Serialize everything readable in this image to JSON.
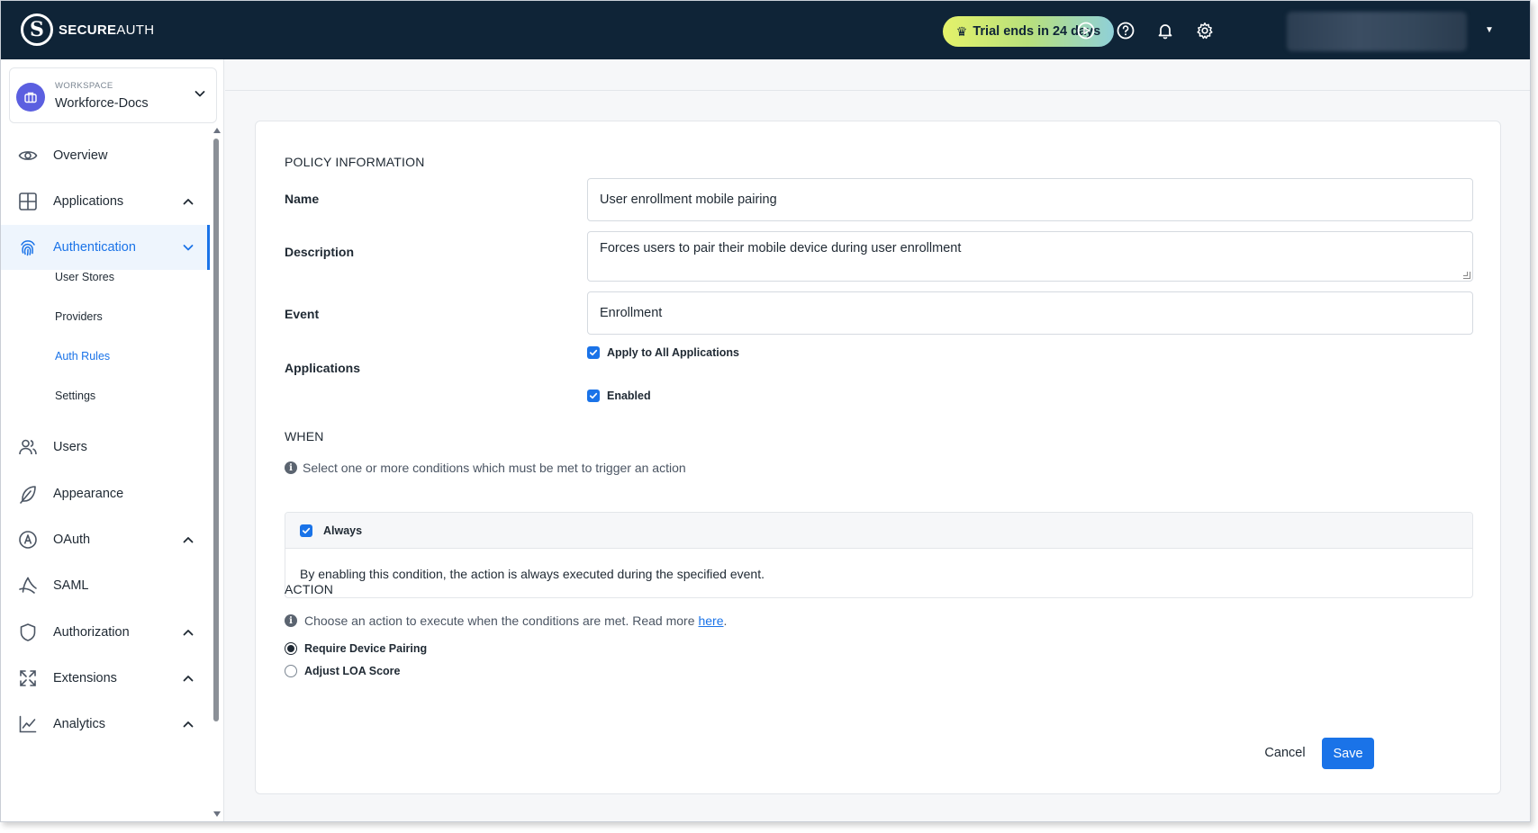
{
  "brand": {
    "name_bold": "SECURE",
    "name_light": "AUTH"
  },
  "header": {
    "trial_text": "Trial ends in 24 days",
    "icons": [
      "play-circle-icon",
      "help-circle-icon",
      "bell-icon",
      "gear-icon"
    ],
    "trial_gradient": [
      "#e4f26a",
      "#8fd0d8"
    ]
  },
  "workspace": {
    "label": "WORKSPACE",
    "name": "Workforce-Docs"
  },
  "sidebar": {
    "items": [
      {
        "label": "Overview",
        "icon": "eye-icon"
      },
      {
        "label": "Applications",
        "icon": "grid-icon"
      },
      {
        "label": "Authentication",
        "icon": "fingerprint-icon",
        "active": true
      },
      {
        "label": "Users",
        "icon": "users-icon"
      },
      {
        "label": "Appearance",
        "icon": "feather-icon"
      },
      {
        "label": "OAuth",
        "icon": "oauth-icon"
      },
      {
        "label": "SAML",
        "icon": "saml-icon"
      },
      {
        "label": "Authorization",
        "icon": "shield-icon"
      },
      {
        "label": "Extensions",
        "icon": "expand-icon"
      },
      {
        "label": "Analytics",
        "icon": "chart-line-icon"
      }
    ],
    "sub_items": [
      {
        "label": "User Stores"
      },
      {
        "label": "Providers"
      },
      {
        "label": "Auth Rules",
        "active": true
      },
      {
        "label": "Settings"
      }
    ]
  },
  "form": {
    "policy_title": "POLICY INFORMATION",
    "name_label": "Name",
    "name_value": "User enrollment mobile pairing",
    "description_label": "Description",
    "description_value": "Forces users to pair their mobile device during user enrollment",
    "event_label": "Event",
    "event_value": "Enrollment",
    "applications_label": "Applications",
    "apply_all_label": "Apply to All Applications",
    "enabled_label": "Enabled",
    "when_title": "WHEN",
    "when_info": "Select one or more conditions which must be met to trigger an action",
    "always_label": "Always",
    "always_desc": "By enabling this condition, the action is always executed during the specified event.",
    "action_title": "ACTION",
    "action_info": "Choose an action to execute when the conditions are met. Read more",
    "action_link": "here",
    "action_info_end": ".",
    "options": [
      {
        "label": "Require Device Pairing",
        "selected": true
      },
      {
        "label": "Adjust LOA Score",
        "selected": false
      }
    ],
    "cancel_label": "Cancel",
    "save_label": "Save"
  },
  "colors": {
    "accent": "#1a73e8",
    "topbar": "#0f2437"
  }
}
